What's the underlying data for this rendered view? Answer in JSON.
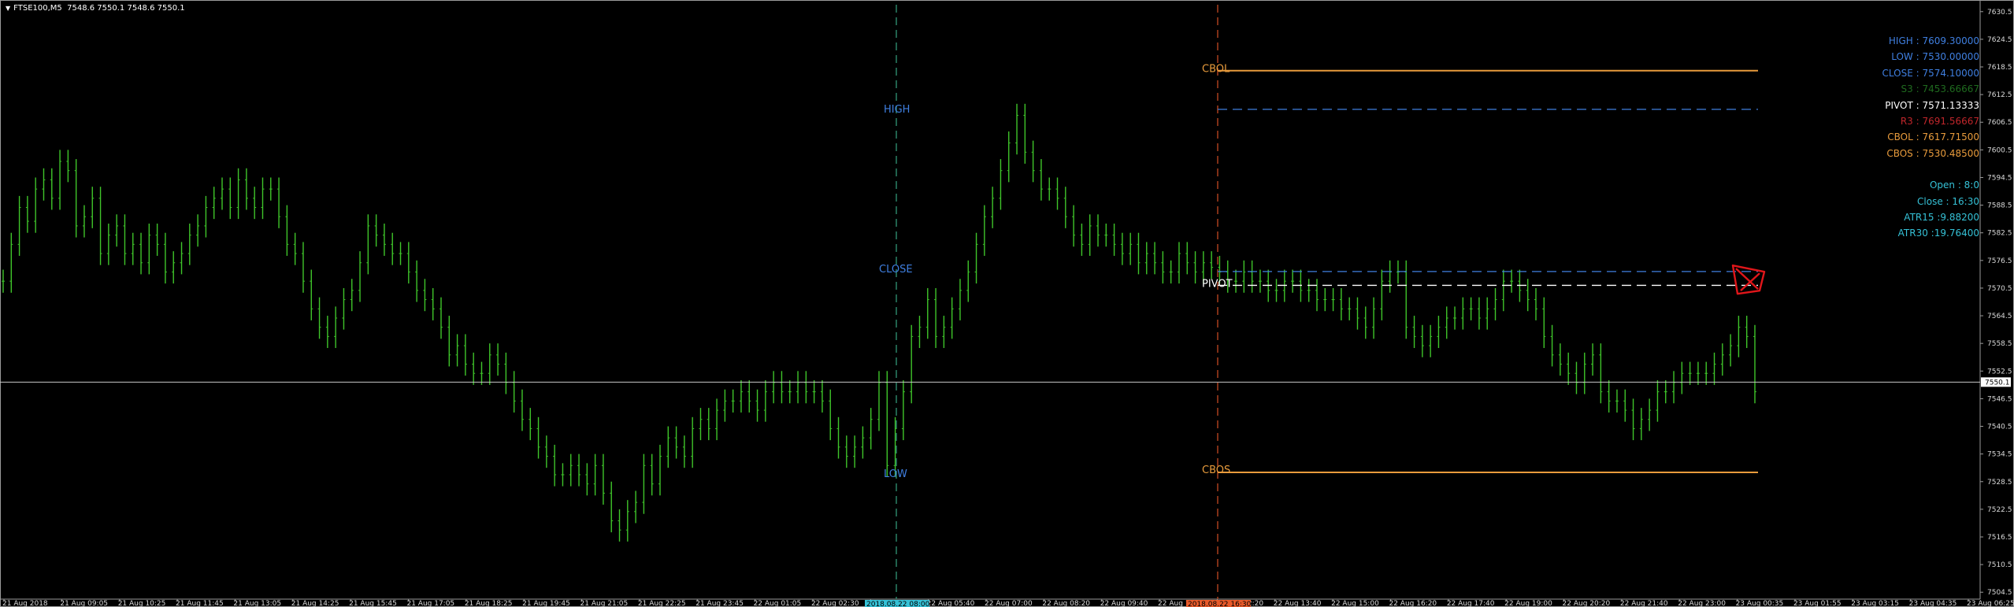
{
  "window": {
    "symbol": "FTSE100,M5",
    "ohlc": "7548.6 7550.1 7548.6 7550.1",
    "menu_glyph": "▼"
  },
  "price_axis": {
    "labels": [
      "7630.5",
      "7624.5",
      "7618.5",
      "7612.5",
      "7606.5",
      "7600.5",
      "7594.5",
      "7588.5",
      "7582.5",
      "7576.5",
      "7570.5",
      "7564.5",
      "7558.5",
      "7552.5",
      "7546.5",
      "7540.5",
      "7534.5",
      "7528.5",
      "7522.5",
      "7516.5",
      "7510.5",
      "7504.5"
    ],
    "current_price": "7550.1",
    "range": [
      7503,
      7632
    ]
  },
  "time_axis": {
    "labels": [
      "21 Aug 2018",
      "21 Aug 09:05",
      "21 Aug 10:25",
      "21 Aug 11:45",
      "21 Aug 13:05",
      "21 Aug 14:25",
      "21 Aug 15:45",
      "21 Aug 17:05",
      "21 Aug 18:25",
      "21 Aug 19:45",
      "21 Aug 21:05",
      "21 Aug 22:25",
      "21 Aug 23:45",
      "22 Aug 01:05",
      "22 Aug 02:30",
      "22 Aug 03:50",
      "22 Aug 05:40",
      "22 Aug 07:00",
      "22 Aug 08:20",
      "22 Aug 09:40",
      "22 Aug 11:00",
      "22 Aug 12:20",
      "22 Aug 13:40",
      "22 Aug 15:00",
      "22 Aug 16:20",
      "22 Aug 17:40",
      "22 Aug 19:00",
      "22 Aug 20:20",
      "22 Aug 21:40",
      "22 Aug 23:00",
      "23 Aug 00:35",
      "23 Aug 01:55",
      "23 Aug 03:15",
      "23 Aug 04:35",
      "23 Aug 06:25"
    ],
    "highlight_cyan": "2018.08.22 08:00",
    "highlight_red": "2018.08.22 16:30"
  },
  "levels": {
    "high_label": "HIGH",
    "close_label": "CLOSE",
    "low_label": "LOW",
    "cbol_label": "CBOL",
    "cbos_label": "CBOS",
    "pivot_label": "PIVOT",
    "cbol": 7617.7,
    "cbos": 7530.5,
    "r3_line": 7609.3,
    "close_line": 7574.1,
    "pivot_line": 7571.1
  },
  "info_panel": [
    {
      "text": "HIGH : 7609.30000",
      "color": "#3f7fe0"
    },
    {
      "text": "LOW : 7530.00000",
      "color": "#3f7fe0"
    },
    {
      "text": "CLOSE : 7574.10000",
      "color": "#3f7fe0"
    },
    {
      "text": "S3 : 7453.66667",
      "color": "#1f6b1f"
    },
    {
      "text": "PIVOT : 7571.13333",
      "color": "#ffffff"
    },
    {
      "text": "R3 : 7691.56667",
      "color": "#c0262b"
    },
    {
      "text": "CBOL : 7617.71500",
      "color": "#e89b3c"
    },
    {
      "text": "CBOS : 7530.48500",
      "color": "#e89b3c"
    },
    {
      "text": "Open : 8:0",
      "color": "#35c1d6"
    },
    {
      "text": "Close : 16:30",
      "color": "#35c1d6"
    },
    {
      "text": "ATR15 :9.88200",
      "color": "#35c1d6"
    },
    {
      "text": "ATR30 :19.76400",
      "color": "#35c1d6"
    }
  ],
  "colors": {
    "background": "#000000",
    "candles": "#3fc52a",
    "axis_text": "#d9d9d9",
    "level_blue": "#3f7fe0",
    "level_orange": "#e89b3c",
    "session_open": "#2e8b6e",
    "session_close": "#b5431f"
  },
  "chart_data": {
    "type": "bar",
    "symbol": "FTSE100",
    "timeframe": "M5",
    "series_close": [
      7572,
      7580,
      7588,
      7585,
      7592,
      7594,
      7590,
      7598,
      7596,
      7584,
      7586,
      7590,
      7578,
      7582,
      7584,
      7578,
      7580,
      7576,
      7582,
      7580,
      7574,
      7576,
      7578,
      7582,
      7584,
      7588,
      7590,
      7592,
      7588,
      7594,
      7590,
      7588,
      7592,
      7592,
      7586,
      7580,
      7578,
      7572,
      7566,
      7562,
      7560,
      7564,
      7568,
      7570,
      7576,
      7584,
      7582,
      7580,
      7578,
      7578,
      7574,
      7570,
      7568,
      7566,
      7562,
      7556,
      7558,
      7554,
      7552,
      7552,
      7556,
      7554,
      7550,
      7546,
      7542,
      7540,
      7536,
      7534,
      7530,
      7530,
      7532,
      7530,
      7528,
      7532,
      7526,
      7520,
      7518,
      7522,
      7524,
      7532,
      7528,
      7534,
      7538,
      7536,
      7534,
      7540,
      7542,
      7540,
      7544,
      7546,
      7546,
      7548,
      7546,
      7544,
      7548,
      7550,
      7548,
      7548,
      7550,
      7548,
      7548,
      7546,
      7540,
      7536,
      7534,
      7536,
      7538,
      7542,
      7550,
      7532,
      7540,
      7548,
      7560,
      7562,
      7568,
      7560,
      7562,
      7566,
      7570,
      7574,
      7580,
      7586,
      7590,
      7596,
      7602,
      7608,
      7600,
      7596,
      7592,
      7592,
      7590,
      7586,
      7582,
      7580,
      7584,
      7582,
      7582,
      7580,
      7578,
      7580,
      7576,
      7578,
      7576,
      7574,
      7574,
      7578,
      7576,
      7574,
      7576,
      7575,
      7574,
      7572,
      7572,
      7574,
      7572,
      7572,
      7570,
      7570,
      7572,
      7572,
      7570,
      7570,
      7568,
      7568,
      7568,
      7566,
      7566,
      7564,
      7562,
      7566,
      7572,
      7574,
      7574,
      7562,
      7560,
      7558,
      7560,
      7562,
      7564,
      7564,
      7566,
      7566,
      7564,
      7566,
      7568,
      7572,
      7572,
      7570,
      7568,
      7566,
      7560,
      7556,
      7554,
      7552,
      7550,
      7554,
      7556,
      7548,
      7546,
      7546,
      7544,
      7540,
      7542,
      7544,
      7548,
      7548,
      7550,
      7552,
      7552,
      7552,
      7552,
      7554,
      7556,
      7558,
      7562,
      7560,
      7548
    ]
  }
}
